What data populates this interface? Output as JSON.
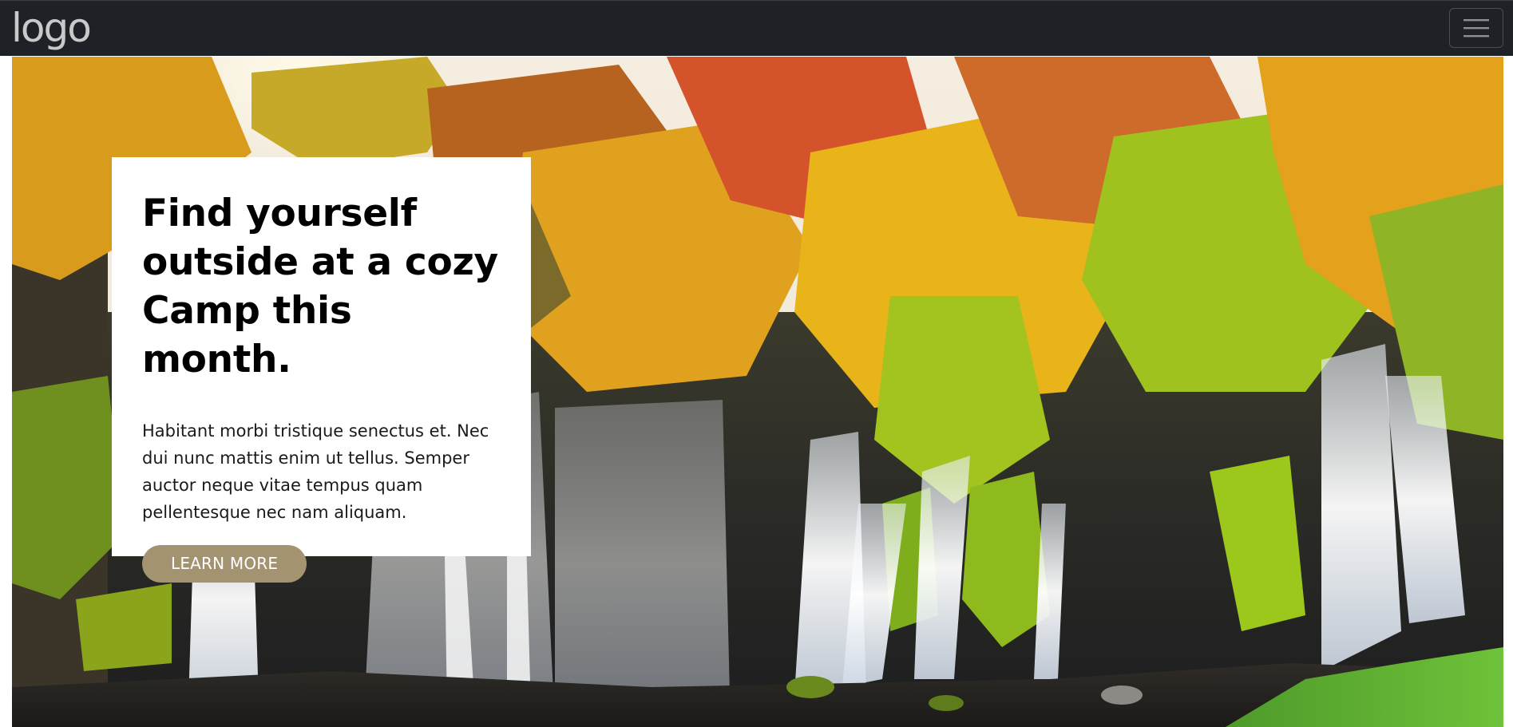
{
  "navbar": {
    "logo_text": "logo",
    "toggle_icon": "hamburger-menu-icon"
  },
  "hero": {
    "image": "waterfall-autumn-forest",
    "title": "Find yourself outside at a cozy Camp this month.",
    "description": "Habitant morbi tristique senectus et. Nec dui nunc mattis enim ut tellus. Semper auctor neque vitae tempus quam pellentesque nec nam aliquam.",
    "cta_label": "LEARN MORE"
  },
  "colors": {
    "navbar_bg": "#1e2125",
    "logo": "#c9c9c9",
    "cta_bg": "#a39370",
    "card_bg": "#ffffff"
  }
}
